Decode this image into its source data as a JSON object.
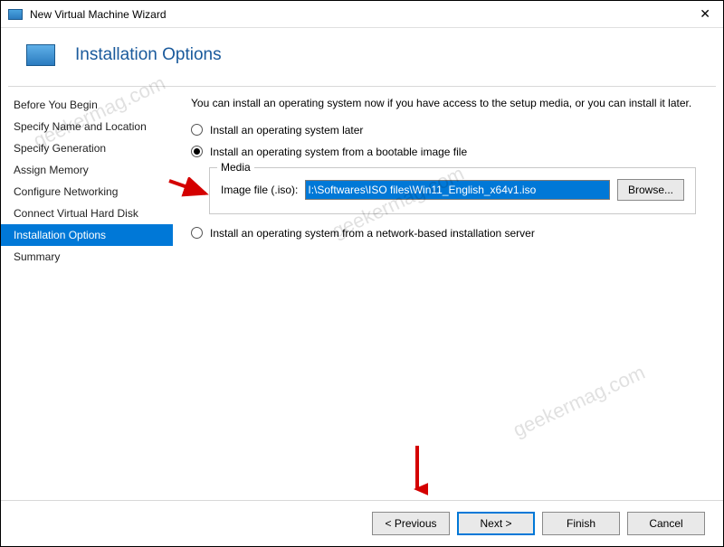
{
  "window": {
    "title": "New Virtual Machine Wizard"
  },
  "header": {
    "title": "Installation Options"
  },
  "sidebar": {
    "items": [
      {
        "label": "Before You Begin"
      },
      {
        "label": "Specify Name and Location"
      },
      {
        "label": "Specify Generation"
      },
      {
        "label": "Assign Memory"
      },
      {
        "label": "Configure Networking"
      },
      {
        "label": "Connect Virtual Hard Disk"
      },
      {
        "label": "Installation Options"
      },
      {
        "label": "Summary"
      }
    ],
    "selected_index": 6
  },
  "content": {
    "intro": "You can install an operating system now if you have access to the setup media, or you can install it later.",
    "options": {
      "later": "Install an operating system later",
      "bootable": "Install an operating system from a bootable image file",
      "network": "Install an operating system from a network-based installation server"
    },
    "selected_option": "bootable",
    "media": {
      "legend": "Media",
      "label": "Image file (.iso):",
      "value": "I:\\Softwares\\ISO files\\Win11_English_x64v1.iso",
      "browse": "Browse..."
    }
  },
  "footer": {
    "previous": "< Previous",
    "next": "Next >",
    "finish": "Finish",
    "cancel": "Cancel"
  },
  "watermark": "geekermag.com"
}
